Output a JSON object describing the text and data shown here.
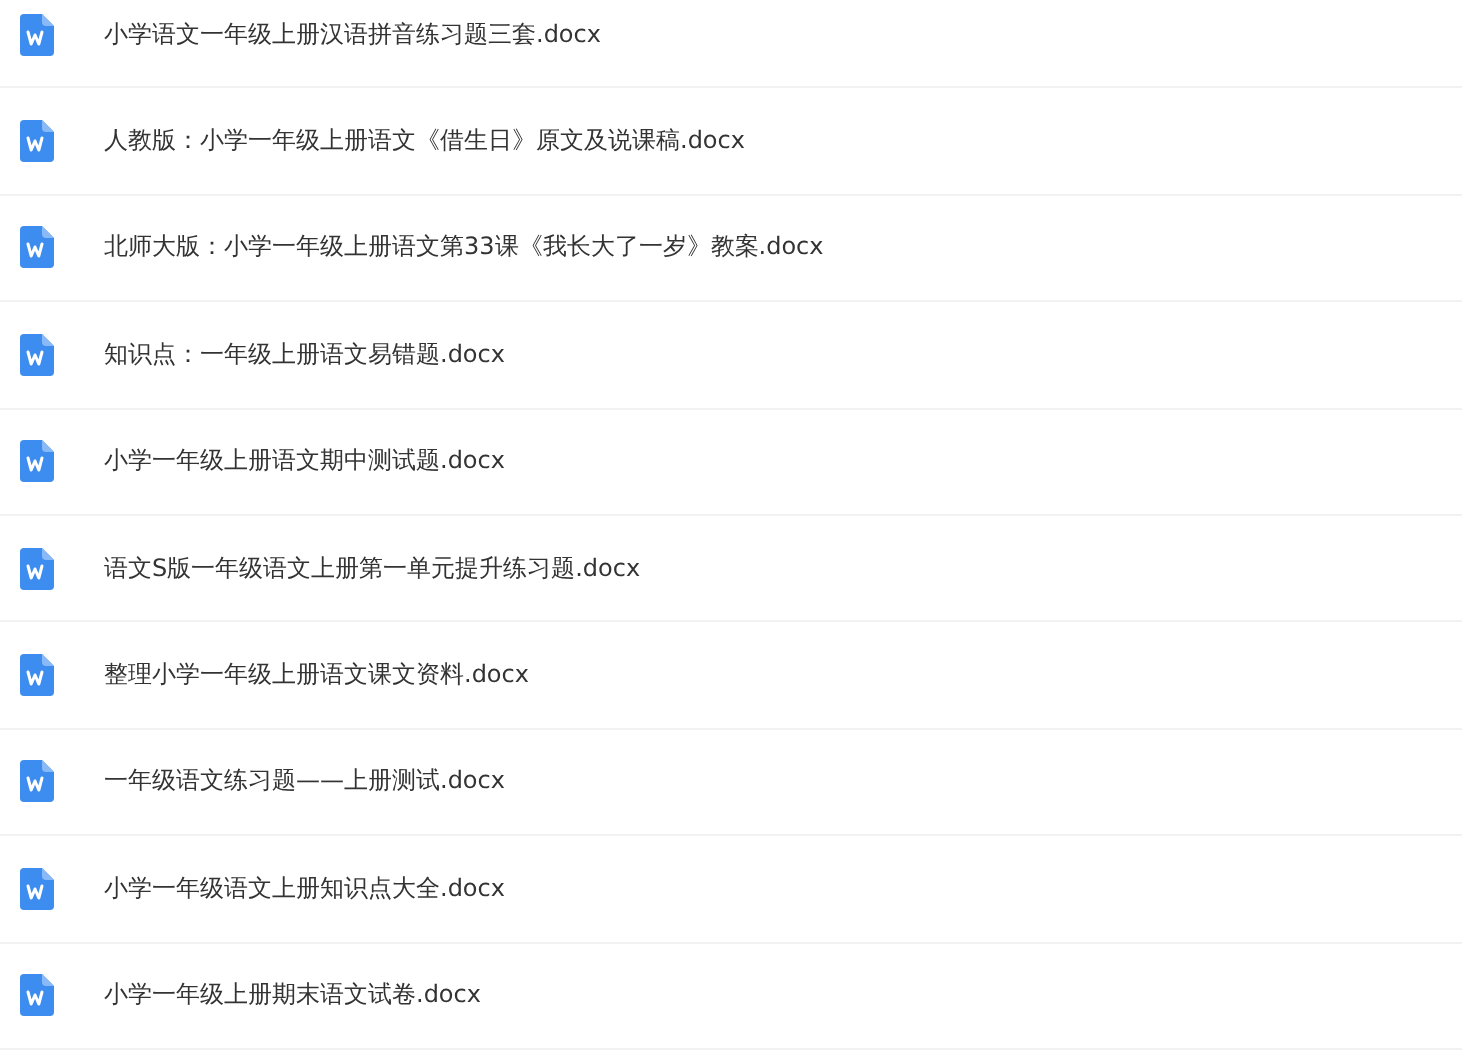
{
  "files": [
    {
      "name": "小学语文一年级上册汉语拼音练习题三套.docx",
      "kind": "word"
    },
    {
      "name": "人教版：小学一年级上册语文《借生日》原文及说课稿.docx",
      "kind": "word"
    },
    {
      "name": "北师大版：小学一年级上册语文第33课《我长大了一岁》教案.docx",
      "kind": "word"
    },
    {
      "name": "知识点：一年级上册语文易错题.docx",
      "kind": "word"
    },
    {
      "name": "小学一年级上册语文期中测试题.docx",
      "kind": "word"
    },
    {
      "name": "语文S版一年级语文上册第一单元提升练习题.docx",
      "kind": "word"
    },
    {
      "name": "整理小学一年级上册语文课文资料.docx",
      "kind": "word"
    },
    {
      "name": "一年级语文练习题——上册测试.docx",
      "kind": "word"
    },
    {
      "name": "小学一年级语文上册知识点大全.docx",
      "kind": "word"
    },
    {
      "name": "小学一年级上册期末语文试卷.docx",
      "kind": "word"
    }
  ]
}
